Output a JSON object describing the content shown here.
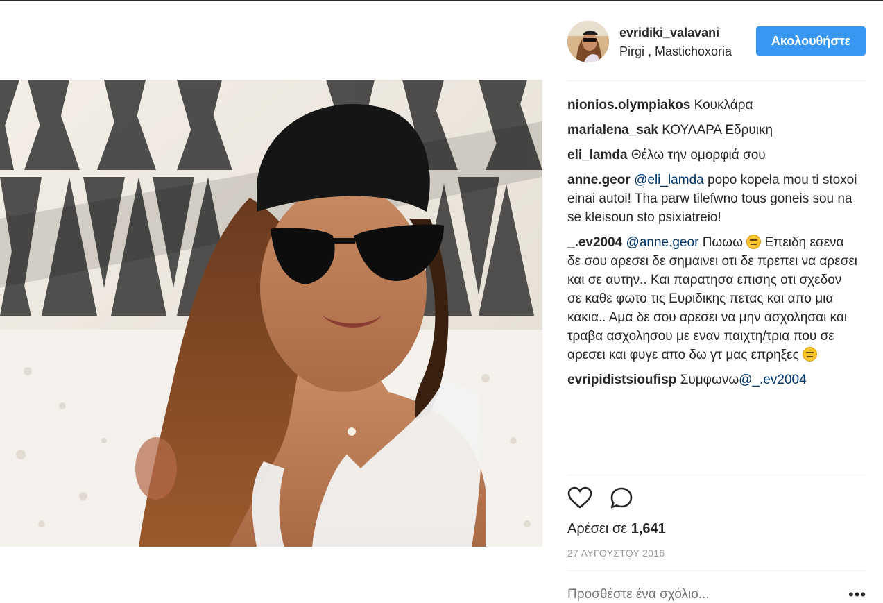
{
  "post": {
    "username": "evridiki_valavani",
    "location": "Pirgi , Mastichoxoria",
    "follow_label": "Ακολουθήστε",
    "photo_icon": "post-photo"
  },
  "comments": [
    {
      "user": "nionios.olympiakos",
      "text": "Κουκλάρα"
    },
    {
      "user": "marialena_sak",
      "text": "ΚΟΥΛΑΡΑ Εδρυικη"
    },
    {
      "user": "eli_lamda",
      "text": "Θέλω την ομορφιά σου"
    },
    {
      "user": "anne.geor",
      "mention": "@eli_lamda",
      "text": "popo kopela mou ti stoxoi einai autoi! Tha parw tilefwno tous goneis sou na se kleisoun sto psixiatreio!"
    },
    {
      "user": "_.ev2004",
      "mention": "@anne.geor",
      "text_a": "Πωωω",
      "text_b": "Επειδη εσενα δε σου αρεσει δε σημαινει οτι δε πρεπει να αρεσει και σε αυτην.. Και παρατησα επισης οτι σχεδον σε καθε φωτο τις Ευριδικης πετας και απο μια κακια.. Αμα δε σου αρεσει να μην ασχολησαι και τραβα ασχολησου με εναν παιχτη/τρια που σε αρεσει και φυγε απο δω γτ μας επρηξες",
      "emoji": "expressionless-face"
    },
    {
      "user": "evripidistsioufisp",
      "text": "Συμφωνω",
      "mention": "@_.ev2004"
    }
  ],
  "actions": {
    "like_icon": "heart-icon",
    "comment_icon": "comment-bubble-icon",
    "likes_prefix": "Αρέσει σε",
    "likes_count": "1,641",
    "date": "27 ΑΥΓΟΥΣΤΟΥ 2016",
    "add_comment_placeholder": "Προσθέστε ένα σχόλιο...",
    "more_icon": "more-options-icon"
  },
  "colors": {
    "accent": "#3897f0",
    "mention": "#003569",
    "muted": "#999999",
    "text": "#262626"
  }
}
